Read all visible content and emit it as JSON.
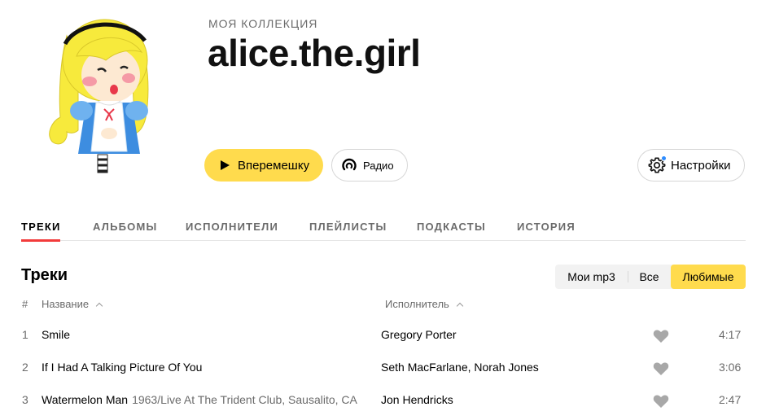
{
  "header": {
    "eyebrow": "МОЯ КОЛЛЕКЦИЯ",
    "username": "alice.the.girl"
  },
  "actions": {
    "shuffle_label": "Вперемешку",
    "radio_label": "Радио",
    "settings_label": "Настройки"
  },
  "tabs": [
    {
      "label": "ТРЕКИ",
      "active": true
    },
    {
      "label": "АЛЬБОМЫ",
      "active": false
    },
    {
      "label": "ИСПОЛНИТЕЛИ",
      "active": false
    },
    {
      "label": "ПЛЕЙЛИСТЫ",
      "active": false
    },
    {
      "label": "ПОДКАСТЫ",
      "active": false
    },
    {
      "label": "ИСТОРИЯ",
      "active": false
    }
  ],
  "section_title": "Треки",
  "filter": {
    "options": [
      "Мои mp3",
      "Все",
      "Любимые"
    ],
    "selected": "Любимые"
  },
  "columns": {
    "num": "#",
    "name": "Название",
    "artist": "Исполнитель"
  },
  "tracks": [
    {
      "num": "1",
      "title": "Smile",
      "version": "",
      "artist": "Gregory Porter",
      "duration": "4:17"
    },
    {
      "num": "2",
      "title": "If I Had A Talking Picture Of You",
      "version": "",
      "artist": "Seth MacFarlane, Norah Jones",
      "duration": "3:06"
    },
    {
      "num": "3",
      "title": "Watermelon Man",
      "version": "1963/Live At The Trident Club, Sausalito, CA",
      "artist": "Jon Hendricks",
      "duration": "2:47"
    }
  ],
  "colors": {
    "accent": "#ffdb4d",
    "tab_underline": "#f23b3b",
    "notification_dot": "#2d8cff",
    "muted_text": "#6b6b6b"
  },
  "icons": {
    "avatar": "cartoon-girl-avatar",
    "shuffle": "play-icon",
    "radio": "radio-icon",
    "settings": "gear-icon",
    "like": "heart-icon"
  }
}
